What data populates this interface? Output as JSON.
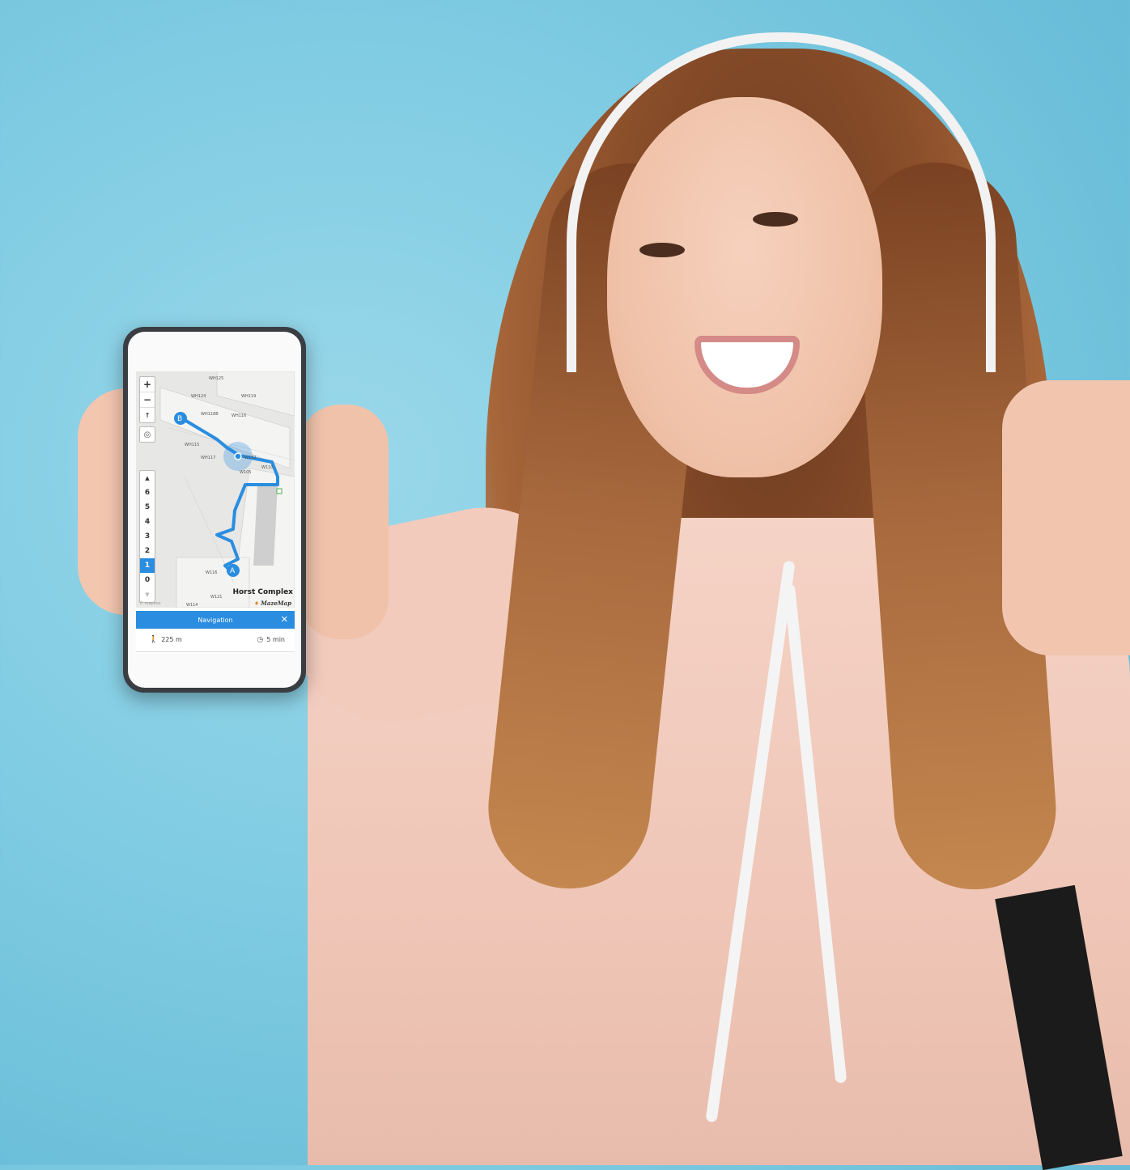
{
  "scene": {
    "description_icon": "woman-holding-phone",
    "background_color": "#7ecbe2"
  },
  "map": {
    "zoom_in": "+",
    "zoom_out": "−",
    "compass": "↑",
    "floors": [
      "6",
      "5",
      "4",
      "3",
      "2",
      "1",
      "0"
    ],
    "active_floor": "1",
    "room_labels": [
      "WH125",
      "WH124",
      "WH119",
      "WH118B",
      "WH116",
      "WH115",
      "WH117",
      "W102",
      "W110",
      "W105",
      "W121",
      "W114",
      "W116"
    ],
    "marker_start": "A",
    "marker_end": "B",
    "building_name": "Horst Complex",
    "brand_name": "MazeMap",
    "attribution": "© mapbox",
    "route_color": "#2a8de0"
  },
  "navigation": {
    "title": "Navigation",
    "close_icon": "close-icon",
    "distance": "225 m",
    "duration": "5 min"
  }
}
